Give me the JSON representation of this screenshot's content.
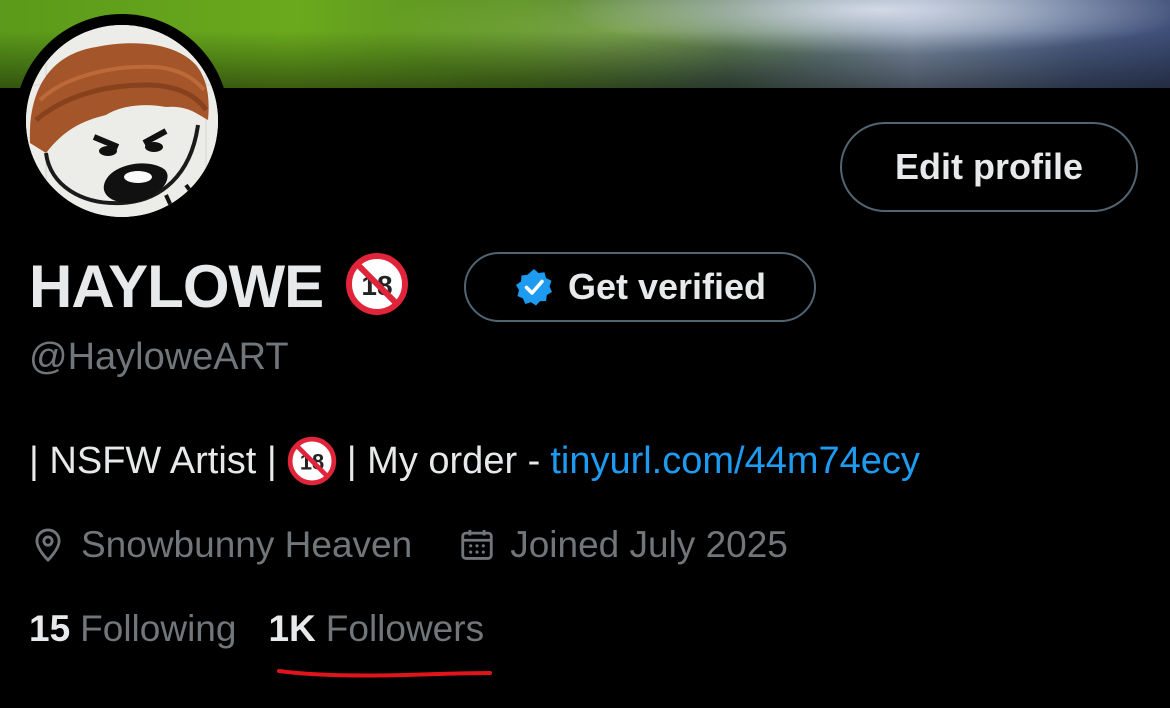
{
  "profile": {
    "display_name": "HAYLOWE",
    "handle": "@HayloweART",
    "edit_profile_label": "Edit profile",
    "get_verified_label": "Get verified",
    "bio": {
      "prefix": "| NSFW Artist |",
      "middle": "| My order -",
      "link": "tinyurl.com/44m74ecy"
    },
    "location": "Snowbunny Heaven",
    "joined": "Joined July 2025",
    "following_count": "15",
    "following_label": "Following",
    "followers_count": "1K",
    "followers_label": "Followers"
  },
  "icons": {
    "adult_content": "no-one-under-eighteen-icon",
    "verified": "verified-badge-icon",
    "location": "location-pin-icon",
    "calendar": "calendar-icon"
  },
  "colors": {
    "background": "#000000",
    "text_primary": "#e7e9ea",
    "text_secondary": "#71767b",
    "link": "#1d9bf0",
    "border": "#536471",
    "annotation_red": "#e0141a"
  }
}
